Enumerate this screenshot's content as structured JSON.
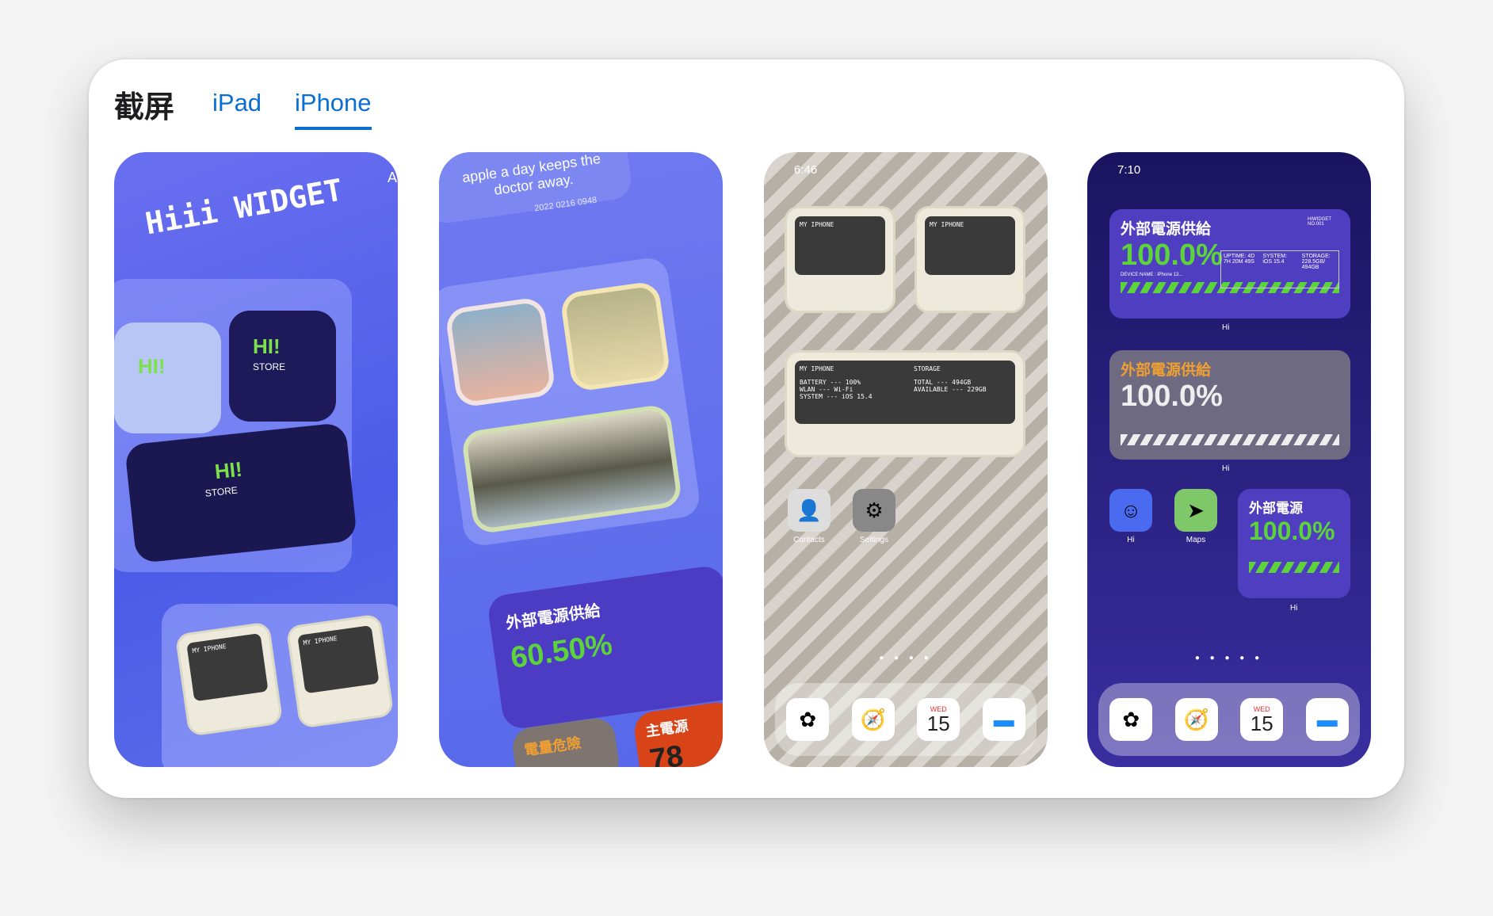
{
  "header": {
    "title": "截屏",
    "tabs": [
      {
        "label": "iPad",
        "active": false
      },
      {
        "label": "iPhone",
        "active": true
      }
    ]
  },
  "accent": "#0a6fd0",
  "screenshots": [
    {
      "logo": "Hiii WIDGET",
      "store_sign": "HI!",
      "store_label": "STORE",
      "device_title": "MY IPHONE",
      "peek": "Ar"
    },
    {
      "quote": "apple a day keeps the doctor away.",
      "date": "2022 0216 0948",
      "power_title": "外部電源供給",
      "percent": "60.50%",
      "danger": "電量危險",
      "main": "主電源",
      "main_value": "78"
    },
    {
      "time": "6:46",
      "w1": "MY IPHONE",
      "w2": "MY IPHONE",
      "w3a": "MY IPHONE",
      "w3b": "STORAGE",
      "battery": "BATTERY --- 100%",
      "wlan": "WLAN --- Wi-Fi",
      "system": "SYSTEM --- iOS 15.4",
      "total": "TOTAL --- 494GB",
      "available": "AVAILABLE --- 229GB",
      "apps": [
        "Contacts",
        "Settings"
      ],
      "dock_date": "WED",
      "dock_day": "15"
    },
    {
      "time": "7:10",
      "power_title": "外部電源供給",
      "id1": "HIWIDGET NO.001",
      "percent": "100.0%",
      "uptime": "UPTIME: 4D 7H 20M 49S",
      "system": "SYSTEM: iOS 15.4",
      "storage": "STORAGE: 228.5GB/ 494GB",
      "device": "DEVICE NAME : iPhone 13...",
      "label": "Hi",
      "small_title": "外部電源",
      "apps": [
        "Hi",
        "Maps"
      ],
      "dock_date": "WED",
      "dock_day": "15"
    }
  ]
}
